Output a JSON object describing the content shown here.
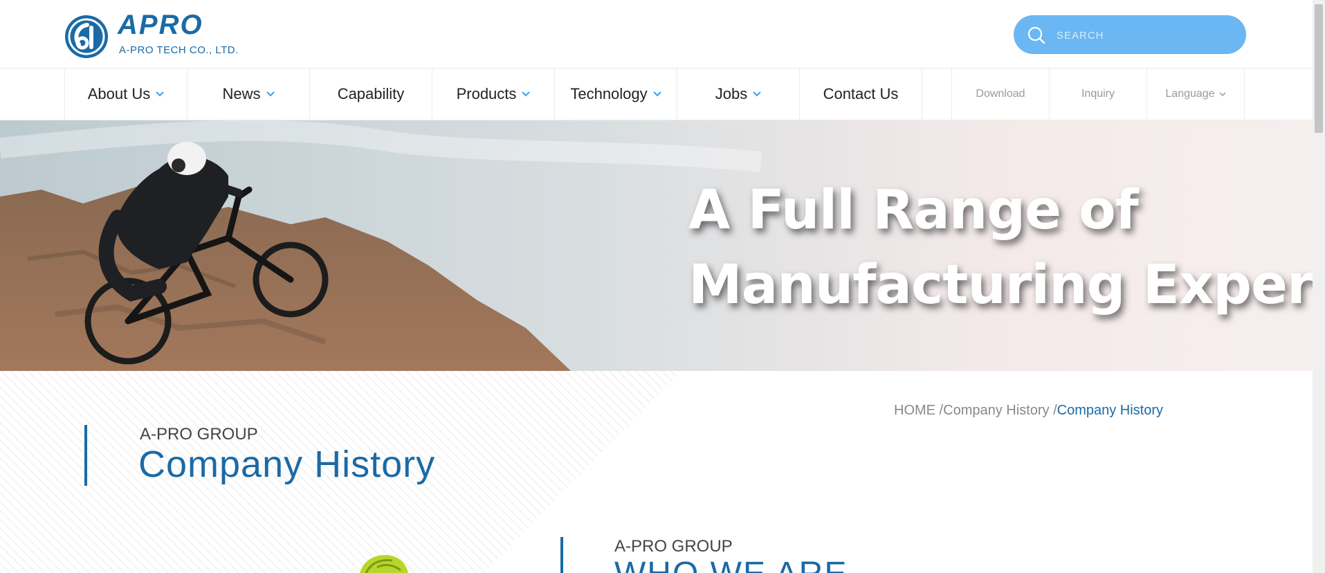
{
  "header": {
    "logo_word": "APRO",
    "logo_subtitle": "A-PRO TECH CO., LTD.",
    "search": {
      "placeholder": "SEARCH"
    }
  },
  "nav": {
    "main": [
      {
        "label": "About Us",
        "dropdown": true
      },
      {
        "label": "News",
        "dropdown": true
      },
      {
        "label": "Capability",
        "dropdown": false
      },
      {
        "label": "Products",
        "dropdown": true
      },
      {
        "label": "Technology",
        "dropdown": true
      },
      {
        "label": "Jobs",
        "dropdown": true
      },
      {
        "label": "Contact Us",
        "dropdown": false
      }
    ],
    "utility": [
      {
        "label": "Download",
        "dropdown": false
      },
      {
        "label": "Inquiry",
        "dropdown": false
      },
      {
        "label": "Language",
        "dropdown": true
      }
    ]
  },
  "banner": {
    "headline_line1": "A Full Range of",
    "headline_line2": "Manufacturing Experts"
  },
  "breadcrumb": {
    "home": "HOME",
    "section": "Company History",
    "current": "Company History"
  },
  "page_header": {
    "eyebrow": "A-PRO GROUP",
    "title": "Company History"
  },
  "who_section": {
    "eyebrow": "A-PRO GROUP",
    "title": "WHO WE ARE"
  },
  "colors": {
    "brand_blue": "#1a6aa6",
    "search_bg": "#6ab7f3",
    "chevron_blue": "#3a9fe8"
  }
}
